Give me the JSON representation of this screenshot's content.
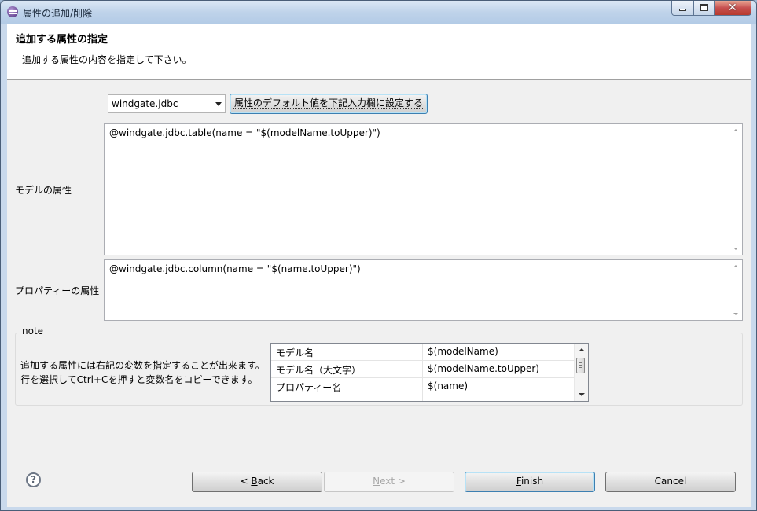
{
  "window": {
    "title": "属性の追加/削除"
  },
  "header": {
    "title": "追加する属性の指定",
    "description": "追加する属性の内容を指定して下さい。"
  },
  "combo": {
    "value": "windgate.jdbc"
  },
  "set_default_button": {
    "label": "属性のデフォルト値を下記入力欄に設定する"
  },
  "model_attribute": {
    "label": "モデルの属性",
    "value": "@windgate.jdbc.table(name = \"$(modelName.toUpper)\")"
  },
  "property_attribute": {
    "label": "プロパティーの属性",
    "value": "@windgate.jdbc.column(name = \"$(name.toUpper)\")"
  },
  "note": {
    "legend": "note",
    "line1": "追加する属性には右記の変数を指定することが出来ます。",
    "line2": "行を選択してCtrl+Cを押すと変数名をコピーできます。",
    "variables": [
      {
        "name": "モデル名",
        "value": "$(modelName)"
      },
      {
        "name": "モデル名（大文字）",
        "value": "$(modelName.toUpper)"
      },
      {
        "name": "プロパティー名",
        "value": "$(name)"
      }
    ]
  },
  "buttons": {
    "back": {
      "pre": "< ",
      "mnemonic": "B",
      "post": "ack"
    },
    "next": {
      "mnemonic": "N",
      "post": "ext >"
    },
    "finish": {
      "mnemonic": "F",
      "post": "inish"
    },
    "cancel": "Cancel"
  },
  "icons": [
    "eclipse-icon",
    "minimize-icon",
    "maximize-icon",
    "close-icon",
    "dropdown-arrow-icon",
    "help-icon"
  ]
}
